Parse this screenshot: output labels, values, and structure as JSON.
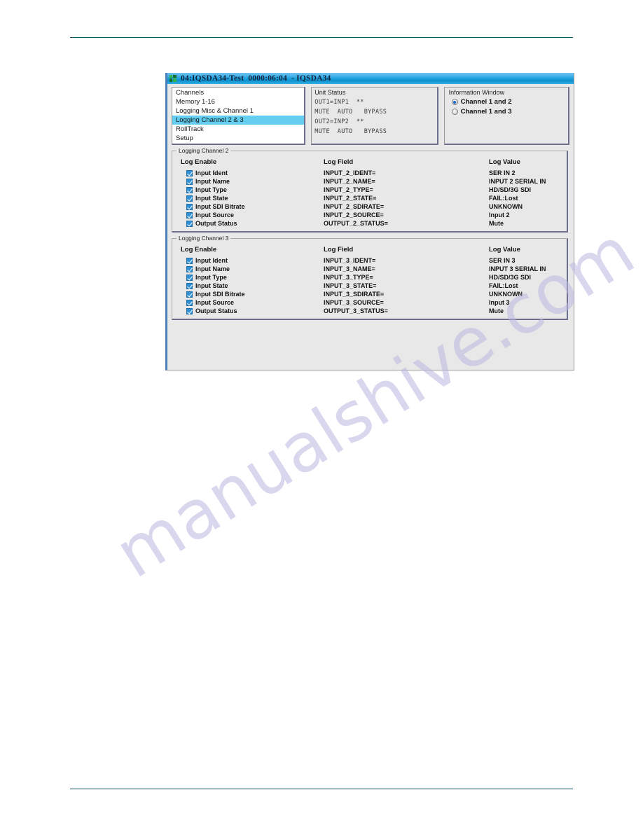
{
  "window": {
    "title": "04:IQSDA34-Test  0000:06:04  - IQSDA34",
    "icon": "grid-icon"
  },
  "channels_list": {
    "items": [
      {
        "label": "Channels",
        "selected": false
      },
      {
        "label": "Memory 1-16",
        "selected": false
      },
      {
        "label": "Logging Misc & Channel 1",
        "selected": false
      },
      {
        "label": "Logging Channel 2 & 3",
        "selected": true
      },
      {
        "label": "RollTrack",
        "selected": false
      },
      {
        "label": "Setup",
        "selected": false
      }
    ]
  },
  "unit_status": {
    "title": "Unit Status",
    "lines": [
      "OUT1=INP1  **",
      "MUTE  AUTO   BYPASS",
      "OUT2=INP2  **",
      "MUTE  AUTO   BYPASS"
    ]
  },
  "information_window": {
    "title": "Information Window",
    "options": [
      {
        "label": "Channel 1 and 2",
        "selected": true
      },
      {
        "label": "Channel 1 and 3",
        "selected": false
      }
    ]
  },
  "log_groups": [
    {
      "legend": "Logging Channel 2",
      "headers": {
        "enable": "Log Enable",
        "field": "Log Field",
        "value": "Log Value"
      },
      "rows": [
        {
          "enable": "Input Ident",
          "checked": true,
          "field": "INPUT_2_IDENT=",
          "value": "SER IN 2"
        },
        {
          "enable": "Input Name",
          "checked": true,
          "field": "INPUT_2_NAME=",
          "value": "INPUT 2 SERIAL IN"
        },
        {
          "enable": "Input Type",
          "checked": true,
          "field": "INPUT_2_TYPE=",
          "value": "HD/SD/3G SDI"
        },
        {
          "enable": "Input State",
          "checked": true,
          "field": "INPUT_2_STATE=",
          "value": "FAIL:Lost"
        },
        {
          "enable": "Input SDI Bitrate",
          "checked": true,
          "field": "INPUT_2_SDIRATE=",
          "value": "UNKNOWN"
        },
        {
          "enable": "Input Source",
          "checked": true,
          "field": "INPUT_2_SOURCE=",
          "value": "Input 2"
        },
        {
          "enable": "Output Status",
          "checked": true,
          "field": "OUTPUT_2_STATUS=",
          "value": "Mute"
        }
      ]
    },
    {
      "legend": "Logging Channel 3",
      "headers": {
        "enable": "Log Enable",
        "field": "Log Field",
        "value": "Log Value"
      },
      "rows": [
        {
          "enable": "Input Ident",
          "checked": true,
          "field": "INPUT_3_IDENT=",
          "value": "SER IN 3"
        },
        {
          "enable": "Input Name",
          "checked": true,
          "field": "INPUT_3_NAME=",
          "value": "INPUT 3 SERIAL IN"
        },
        {
          "enable": "Input Type",
          "checked": true,
          "field": "INPUT_3_TYPE=",
          "value": "HD/SD/3G SDI"
        },
        {
          "enable": "Input State",
          "checked": true,
          "field": "INPUT_3_STATE=",
          "value": "FAIL:Lost"
        },
        {
          "enable": "Input SDI Bitrate",
          "checked": true,
          "field": "INPUT_3_SDIRATE=",
          "value": "UNKNOWN"
        },
        {
          "enable": "Input Source",
          "checked": true,
          "field": "INPUT_3_SOURCE=",
          "value": "Input 3"
        },
        {
          "enable": "Output Status",
          "checked": true,
          "field": "OUTPUT_3_STATUS=",
          "value": "Mute"
        }
      ]
    }
  ],
  "watermark": {
    "text": "manualshive.com"
  },
  "colors": {
    "rule": "#12556b",
    "selection": "#63cef0",
    "checkbox": "#2e8fd6",
    "radio": "#1569c7",
    "watermark": "#b9b7e0"
  }
}
